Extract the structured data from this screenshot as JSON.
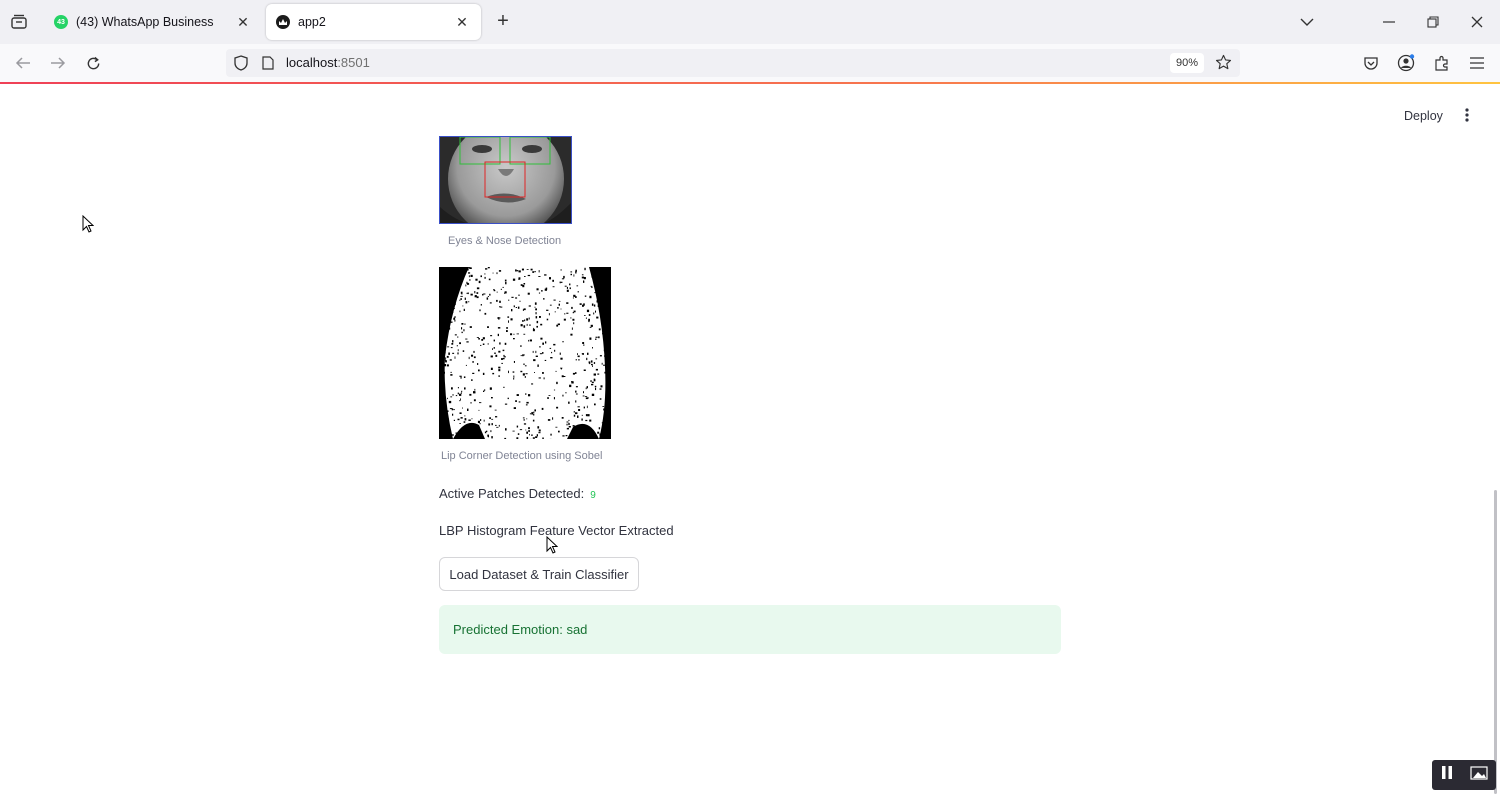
{
  "browser": {
    "tabs": [
      {
        "title": "(43) WhatsApp Business",
        "badge": "43",
        "active": false
      },
      {
        "title": "app2",
        "active": true
      }
    ],
    "url": {
      "host": "localhost",
      "port": ":8501"
    },
    "zoom": "90%"
  },
  "app": {
    "header": {
      "deploy_label": "Deploy"
    },
    "images": {
      "eyes_caption": "Eyes & Nose Detection",
      "lip_caption": "Lip Corner Detection using Sobel"
    },
    "patches": {
      "label": "Active Patches Detected:",
      "value": "9"
    },
    "lbp_text": "LBP Histogram Feature Vector Extracted",
    "train_button": "Load Dataset & Train Classifier",
    "result": {
      "text": "Predicted Emotion: sad"
    }
  },
  "colors": {
    "success_bg": "#e8f9ee",
    "success_text": "#177233",
    "accent_green": "#21c354"
  }
}
